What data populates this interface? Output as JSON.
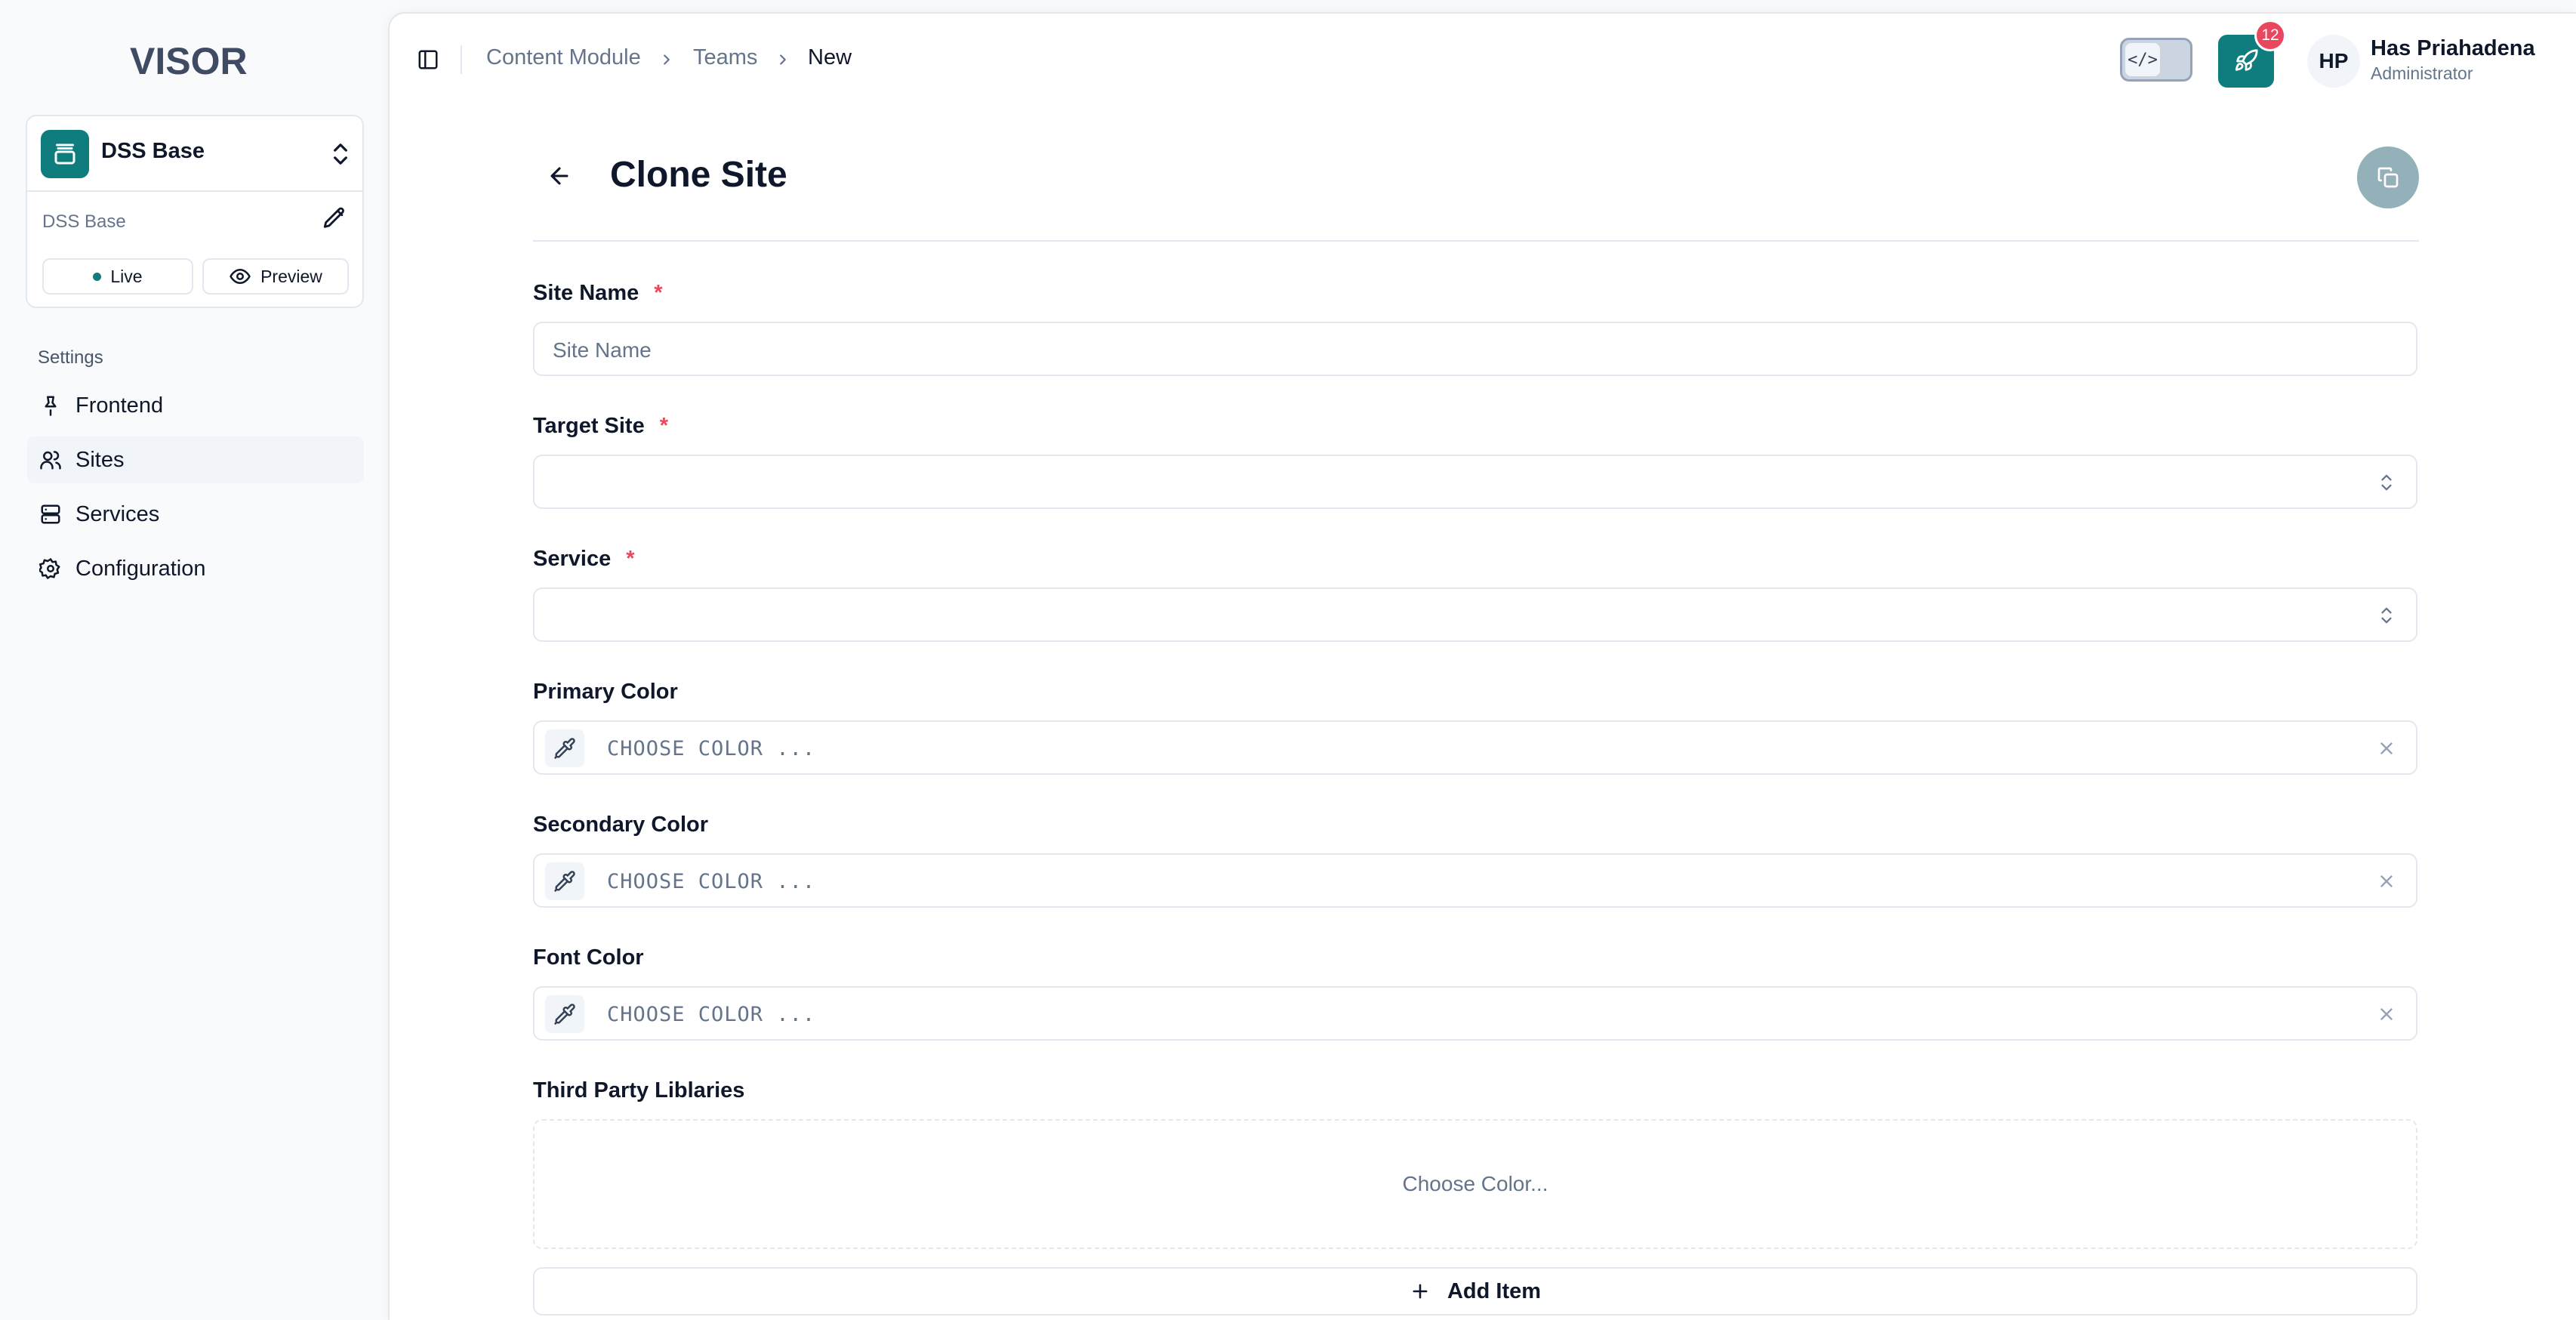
{
  "brand": {
    "logo_text": "VISOR",
    "accent": "#0f7d7d"
  },
  "site_switcher": {
    "title": "DSS Base",
    "subtitle": "DSS Base",
    "live_label": "Live",
    "preview_label": "Preview"
  },
  "sidebar": {
    "section_label": "Settings",
    "items": [
      {
        "label": "Frontend",
        "icon": "pin-icon"
      },
      {
        "label": "Sites",
        "icon": "users-icon"
      },
      {
        "label": "Services",
        "icon": "server-icon"
      },
      {
        "label": "Configuration",
        "icon": "gear-icon"
      }
    ]
  },
  "header": {
    "breadcrumb": [
      "Content Module",
      "Teams",
      "New"
    ],
    "notification_count": "12",
    "code_toggle_label": "</>",
    "user": {
      "initials": "HP",
      "name": "Has Priahadena",
      "role": "Administrator"
    }
  },
  "form": {
    "title": "Clone Site",
    "site_name": {
      "label": "Site Name",
      "required_mark": "*",
      "placeholder": "Site Name"
    },
    "target_site": {
      "label": "Target Site",
      "required_mark": "*"
    },
    "service": {
      "label": "Service",
      "required_mark": "*"
    },
    "primary_color": {
      "label": "Primary Color",
      "placeholder": "CHOOSE COLOR ..."
    },
    "secondary_color": {
      "label": "Secondary Color",
      "placeholder": "CHOOSE COLOR ..."
    },
    "font_color": {
      "label": "Font Color",
      "placeholder": "CHOOSE COLOR ..."
    },
    "third_party": {
      "label": "Third Party Liblaries",
      "dropzone_text": "Choose Color..."
    },
    "add_item_label": "Add Item"
  }
}
